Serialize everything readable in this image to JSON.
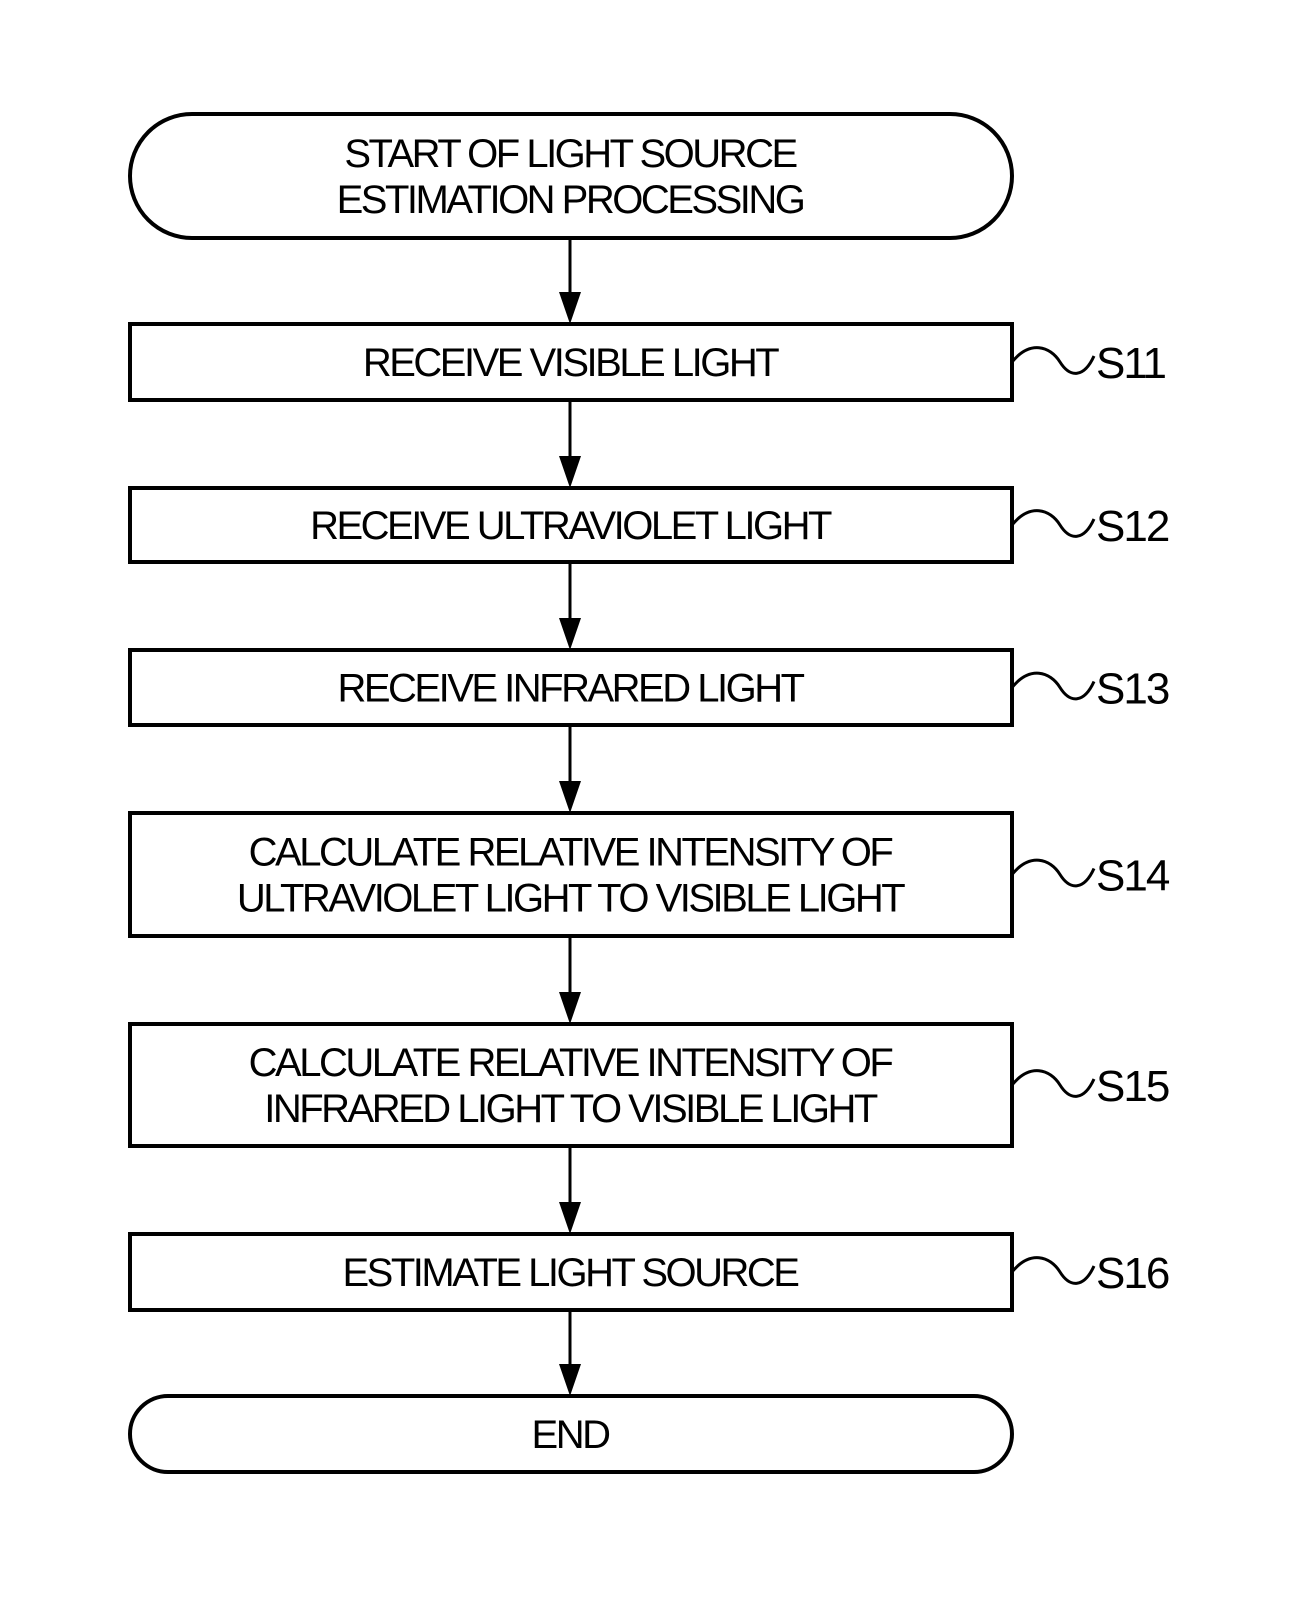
{
  "flowchart": {
    "start": {
      "lines": [
        "START OF LIGHT SOURCE",
        "ESTIMATION PROCESSING"
      ],
      "shape": "terminal"
    },
    "steps": [
      {
        "id": "S11",
        "lines": [
          "RECEIVE VISIBLE LIGHT"
        ]
      },
      {
        "id": "S12",
        "lines": [
          "RECEIVE ULTRAVIOLET LIGHT"
        ]
      },
      {
        "id": "S13",
        "lines": [
          "RECEIVE INFRARED LIGHT"
        ]
      },
      {
        "id": "S14",
        "lines": [
          "CALCULATE RELATIVE INTENSITY OF",
          "ULTRAVIOLET LIGHT TO VISIBLE LIGHT"
        ]
      },
      {
        "id": "S15",
        "lines": [
          "CALCULATE RELATIVE INTENSITY OF",
          "INFRARED LIGHT TO VISIBLE LIGHT"
        ]
      },
      {
        "id": "S16",
        "lines": [
          "ESTIMATE LIGHT SOURCE"
        ]
      }
    ],
    "end": {
      "lines": [
        "END"
      ],
      "shape": "terminal"
    },
    "edges": [
      [
        "start",
        "S11"
      ],
      [
        "S11",
        "S12"
      ],
      [
        "S12",
        "S13"
      ],
      [
        "S13",
        "S14"
      ],
      [
        "S14",
        "S15"
      ],
      [
        "S15",
        "S16"
      ],
      [
        "S16",
        "end"
      ]
    ]
  }
}
